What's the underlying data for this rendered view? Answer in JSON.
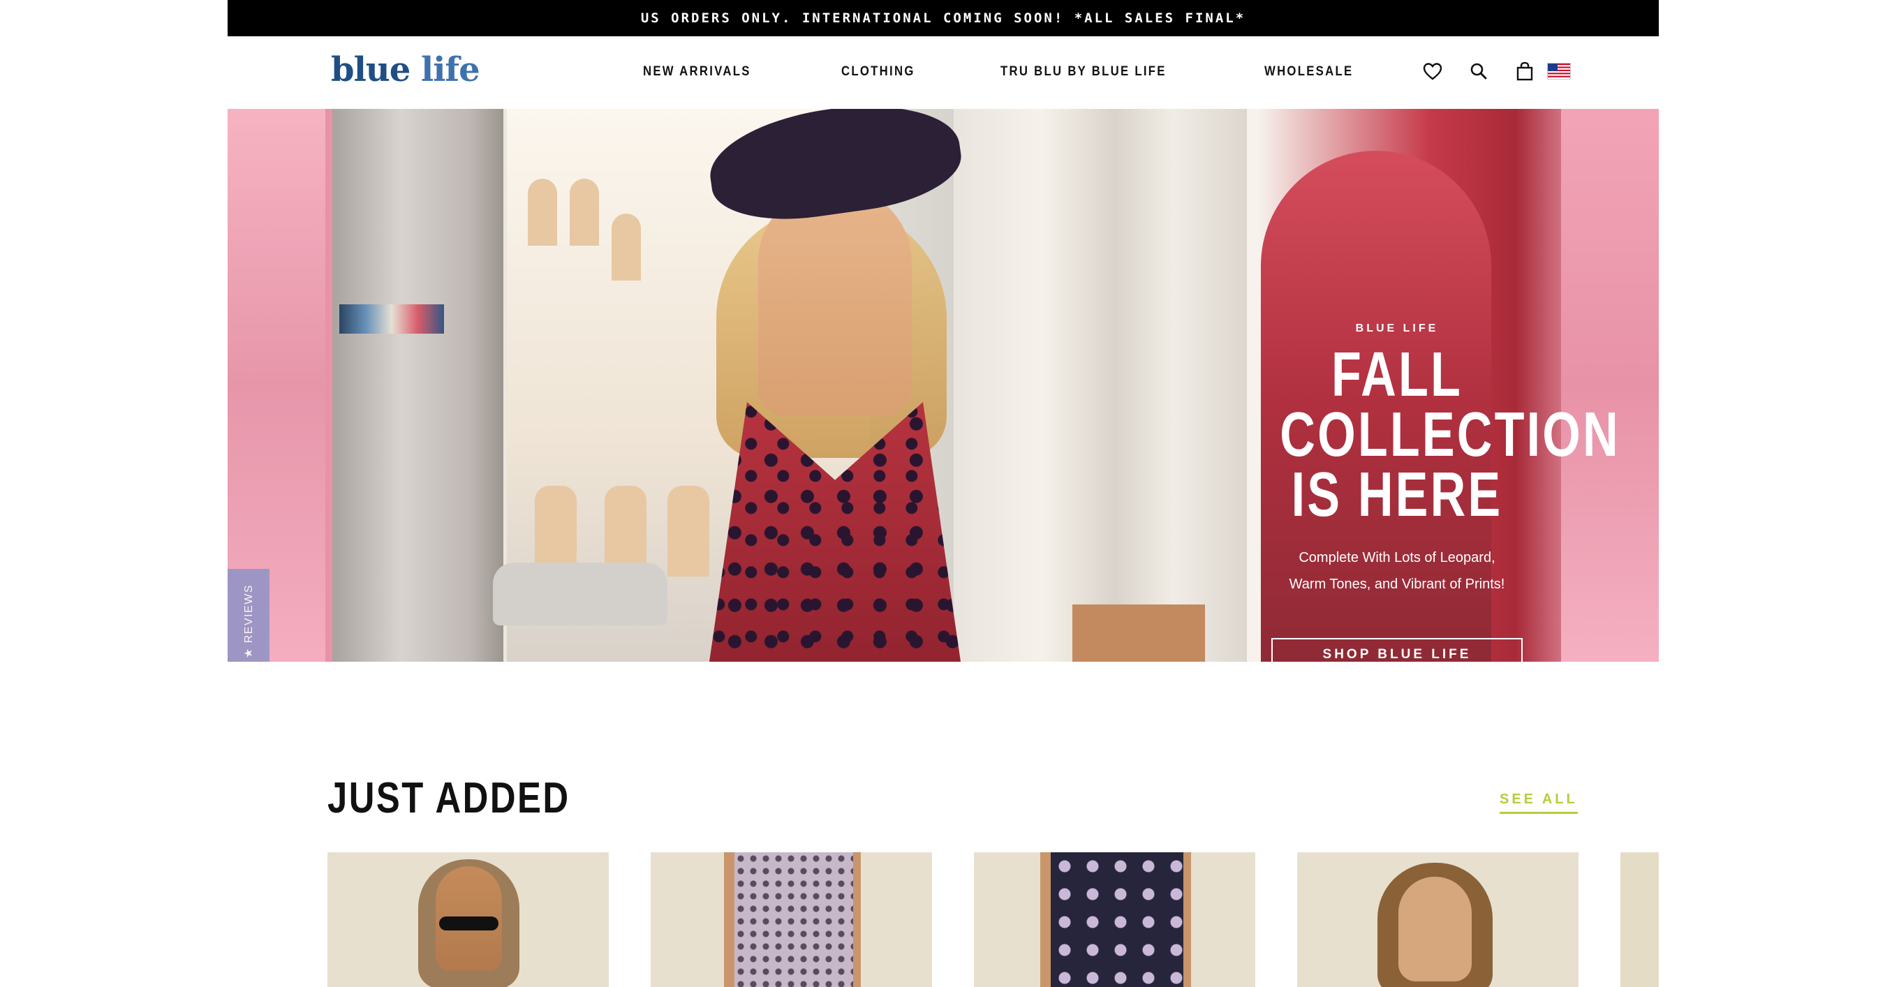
{
  "announcement": "US ORDERS ONLY. INTERNATIONAL COMING SOON! *ALL SALES FINAL*",
  "header": {
    "logo_word1": "blue",
    "logo_word2": "life",
    "nav": [
      "NEW ARRIVALS",
      "CLOTHING",
      "TRU BLU BY BLUE LIFE",
      "WHOLESALE"
    ],
    "icons": [
      "heart-icon",
      "search-icon",
      "bag-icon",
      "us-flag-icon"
    ]
  },
  "hero": {
    "eyebrow": "BLUE LIFE",
    "title_line1": "FALL",
    "title_line2": "COLLECTION",
    "title_line3": "IS HERE",
    "subtitle_line1": "Complete With Lots of Leopard,",
    "subtitle_line2": "Warm Tones, and Vibrant of Prints!",
    "button": "SHOP BLUE LIFE"
  },
  "reviews_tab": "★ REVIEWS",
  "just_added": {
    "heading": "JUST ADDED",
    "see_all": "SEE ALL"
  },
  "colors": {
    "logo_blue": "#1f4e85",
    "accent_green": "#b3cf3a",
    "announce_bg": "#000000",
    "reviews_tab": "#8f93c6"
  }
}
